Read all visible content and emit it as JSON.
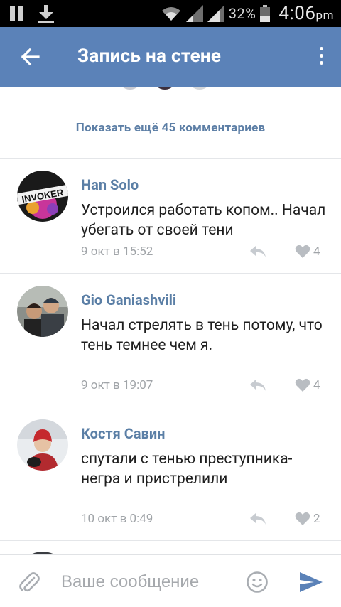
{
  "status_bar": {
    "battery_percent": "32%",
    "time": "4:06",
    "time_suffix": "pm"
  },
  "toolbar": {
    "title": "Запись на стене"
  },
  "show_more": "Показать ещё 45 комментариев",
  "comments": [
    {
      "author": "Han Solo",
      "text": "Устроился работать копом.. Начал убегать от своей тени",
      "date": "9 окт в 15:52",
      "likes": "4"
    },
    {
      "author": "Gio Ganiashvili",
      "text": "Начал стрелять в тень потому, что тень темнее чем я.",
      "date": "9 окт в 19:07",
      "likes": "4"
    },
    {
      "author": "Костя Савин",
      "text": "спутали с тенью преступника-негра и пристрелили",
      "date": "10 окт в 0:49",
      "likes": "2"
    }
  ],
  "composer": {
    "placeholder": "Ваше сообщение"
  },
  "colors": {
    "toolbar": "#5b82b8",
    "link": "#5b7fa6",
    "meta": "#a0a4a8"
  }
}
